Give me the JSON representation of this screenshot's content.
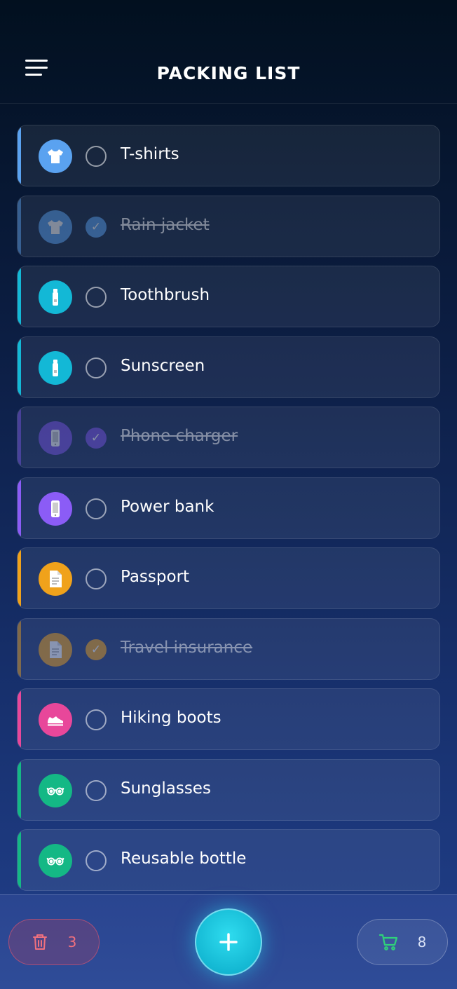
{
  "header": {
    "title": "PACKING LIST"
  },
  "items": [
    {
      "label": "T-shirts",
      "done": false,
      "color": "#5aa2f0",
      "icon": "shirt-icon"
    },
    {
      "label": "Rain jacket",
      "done": true,
      "color": "#5aa2f0",
      "icon": "shirt-icon"
    },
    {
      "label": "Toothbrush",
      "done": false,
      "color": "#13b8d6",
      "icon": "tube-icon"
    },
    {
      "label": "Sunscreen",
      "done": false,
      "color": "#13b8d6",
      "icon": "tube-icon"
    },
    {
      "label": "Phone charger",
      "done": true,
      "color": "#7b55e6",
      "icon": "phone-icon"
    },
    {
      "label": "Power bank",
      "done": false,
      "color": "#8b5cf6",
      "icon": "phone-icon"
    },
    {
      "label": "Passport",
      "done": false,
      "color": "#f0a21b",
      "icon": "document-icon"
    },
    {
      "label": "Travel insurance",
      "done": true,
      "color": "#f0a21b",
      "icon": "document-icon"
    },
    {
      "label": "Hiking boots",
      "done": false,
      "color": "#e8479a",
      "icon": "shoe-icon"
    },
    {
      "label": "Sunglasses",
      "done": false,
      "color": "#14b885",
      "icon": "glasses-icon"
    },
    {
      "label": "Reusable bottle",
      "done": false,
      "color": "#14b885",
      "icon": "glasses-icon"
    }
  ],
  "check_mark": "✓",
  "bottom": {
    "trash_count": "3",
    "cart_count": "8",
    "add_symbol": "+"
  }
}
